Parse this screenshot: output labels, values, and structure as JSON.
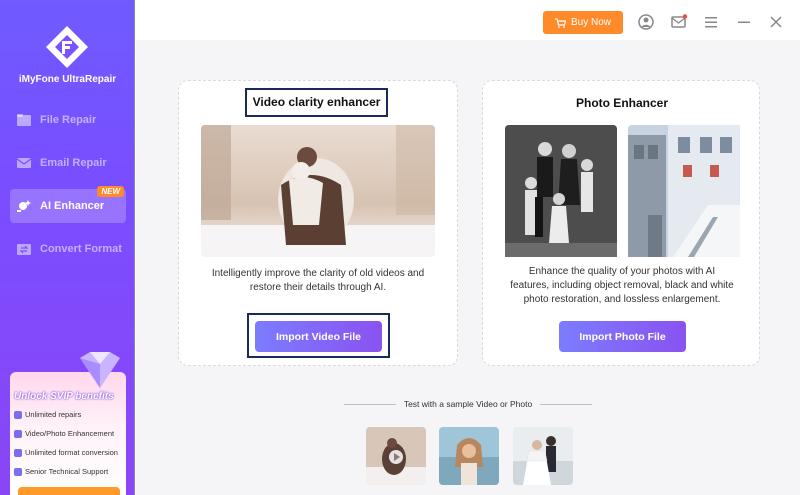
{
  "app": {
    "brand": "iMyFone UltraRepair"
  },
  "sidebar": {
    "items": [
      {
        "label": "File Repair",
        "icon": "file-repair-icon",
        "active": false
      },
      {
        "label": "Email Repair",
        "icon": "email-icon",
        "active": false
      },
      {
        "label": "AI Enhancer",
        "icon": "ai-enhancer-icon",
        "active": true,
        "badge": "NEW"
      },
      {
        "label": "Convert Format",
        "icon": "convert-format-icon",
        "active": false
      }
    ],
    "svip": {
      "title": "Unlock SVIP benefits",
      "benefits": [
        "Unlimited repairs",
        "Video/Photo Enhancement",
        "Unlimited format conversion",
        "Senior Technical Support"
      ]
    }
  },
  "titlebar": {
    "buy_label": "Buy Now",
    "icons": [
      "account-icon",
      "mail-icon",
      "menu-icon",
      "minimize-icon",
      "close-icon"
    ]
  },
  "main": {
    "video_card": {
      "title": "Video clarity enhancer",
      "description_line1": "Intelligently improve the clarity of old videos and",
      "description_line2": "restore their details through AI.",
      "button_label": "Import Video File"
    },
    "photo_card": {
      "title": "Photo Enhancer",
      "description_line1": "Enhance the quality of your photos with AI",
      "description_line2": "features, including object removal, black and white",
      "description_line3": "photo restoration, and lossless enlargement.",
      "button_label": "Import Photo File"
    },
    "sample": {
      "label": "Test with a sample Video or Photo"
    }
  },
  "colors": {
    "sidebar_top": "#6f5bff",
    "sidebar_bottom": "#8a46f5",
    "accent_orange": "#ff8a2a",
    "button_gradient_start": "#7c7cff",
    "button_gradient_end": "#8a52f0"
  }
}
